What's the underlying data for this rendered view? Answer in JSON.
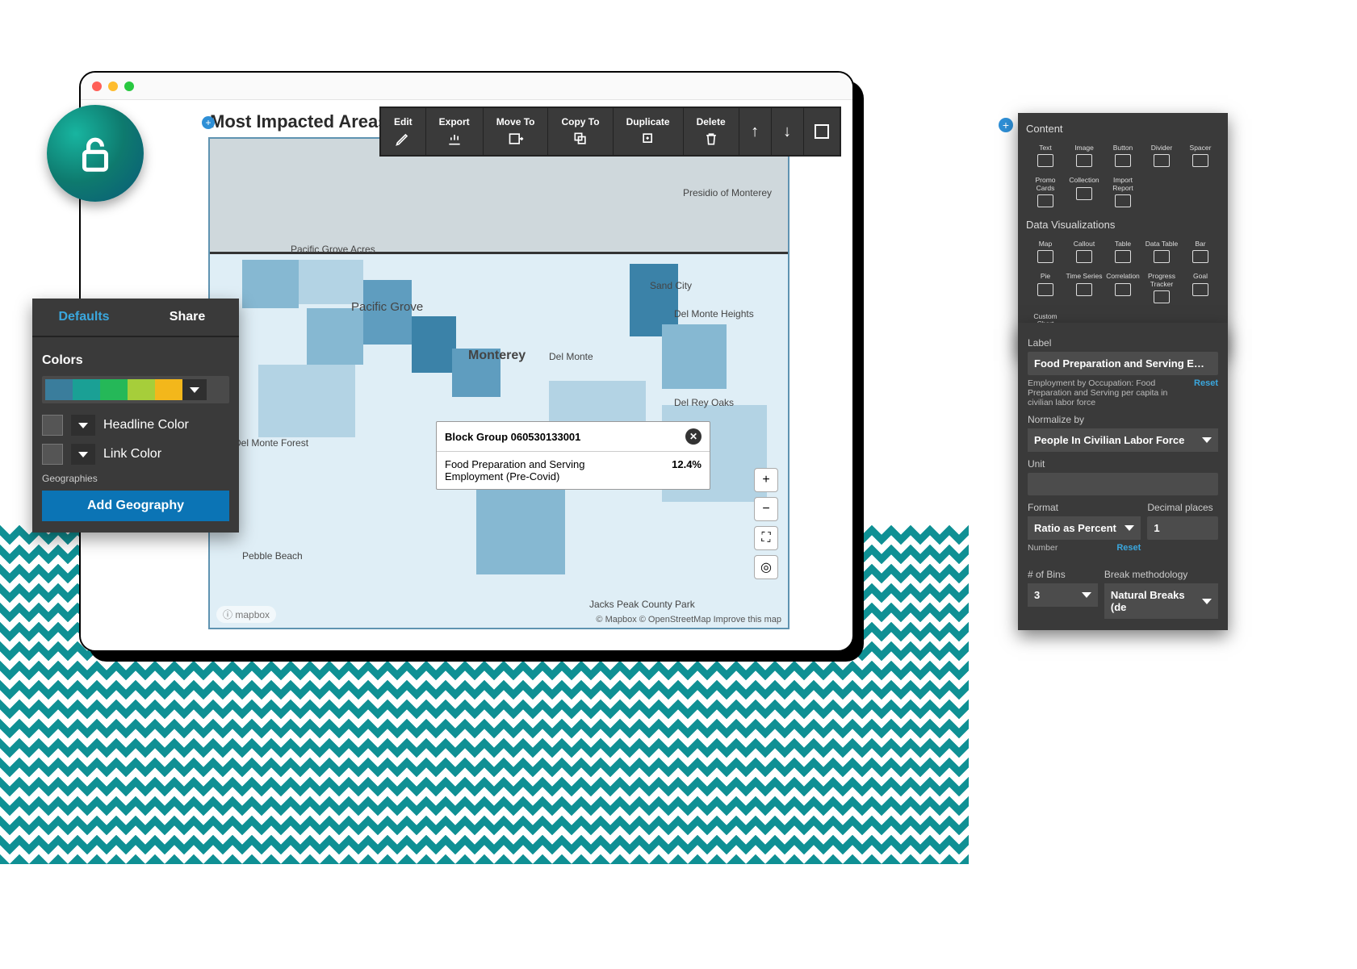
{
  "window": {
    "title": "Most Impacted Areas: F"
  },
  "toolbar": {
    "edit": "Edit",
    "export": "Export",
    "move_to": "Move To",
    "copy_to": "Copy To",
    "duplicate": "Duplicate",
    "delete": "Delete"
  },
  "map": {
    "labels": {
      "pacific_grove_acres": "Pacific Grove Acres",
      "pacific_grove": "Pacific Grove",
      "monterey": "Monterey",
      "del_monte": "Del Monte",
      "del_monte_forest": "Del Monte Forest",
      "presidio": "Presidio of Monterey",
      "sand_city": "Sand City",
      "del_monte_heights": "Del Monte Heights",
      "del_rey_oaks": "Del Rey Oaks",
      "pebble_beach": "Pebble Beach",
      "jacks_peak": "Jacks Peak County Park"
    },
    "tooltip": {
      "header": "Block Group 060530133001",
      "metric_label": "Food Preparation and Serving Employment (Pre-Covid)",
      "metric_value": "12.4%"
    },
    "attribution": "© Mapbox © OpenStreetMap Improve this map",
    "logo": "mapbox"
  },
  "style_panel": {
    "tabs": {
      "defaults": "Defaults",
      "share": "Share"
    },
    "colors_h": "Colors",
    "palette": [
      "#3a7d9c",
      "#1aa095",
      "#25b858",
      "#a6ce3a",
      "#f3b71b"
    ],
    "headline_color": "Headline Color",
    "link_color": "Link Color",
    "geographies_h": "Geographies",
    "add_geo": "Add Geography"
  },
  "content_panel": {
    "content_h": "Content",
    "content_items": [
      "Text",
      "Image",
      "Button",
      "Divider",
      "Spacer",
      "Promo Cards",
      "Collection",
      "Import Report"
    ],
    "viz_h": "Data Visualizations",
    "viz_items": [
      "Map",
      "Callout",
      "Table",
      "Data Table",
      "Bar",
      "Pie",
      "Time Series",
      "Correlation",
      "Progress Tracker",
      "Goal",
      "Custom Chart"
    ]
  },
  "fmt_panel": {
    "label_h": "Label",
    "label_value": "Food Preparation and Serving Empl",
    "desc": "Employment by Occupation: Food Preparation and Serving per capita in civilian labor force",
    "reset": "Reset",
    "normalize_h": "Normalize by",
    "normalize_value": "People In Civilian Labor Force",
    "unit_h": "Unit",
    "unit_value": "",
    "format_h": "Format",
    "format_value": "Ratio as Percent",
    "format_sub": "Number",
    "decimal_h": "Decimal places",
    "decimal_value": "1",
    "bins_h": "# of Bins",
    "bins_value": "3",
    "break_h": "Break methodology",
    "break_value": "Natural Breaks (de"
  }
}
